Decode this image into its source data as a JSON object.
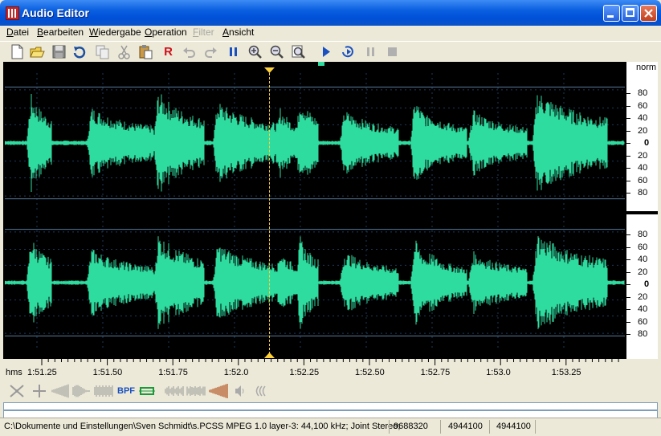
{
  "window": {
    "title": "Audio Editor"
  },
  "menu": [
    {
      "label": "Datei",
      "key": "D",
      "rest": "atei",
      "disabled": false
    },
    {
      "label": "Bearbeiten",
      "key": "B",
      "rest": "earbeiten",
      "disabled": false
    },
    {
      "label": "Wiedergabe",
      "key": "W",
      "rest": "iedergabe",
      "disabled": false
    },
    {
      "label": "Operation",
      "key": "O",
      "rest": "peration",
      "disabled": false
    },
    {
      "label": "Filter",
      "key": "F",
      "rest": "ilter",
      "disabled": true
    },
    {
      "label": "Ansicht",
      "key": "A",
      "rest": "nsicht",
      "disabled": false
    }
  ],
  "toolbar": {
    "buttons": [
      "new-file-icon",
      "open-folder-icon",
      "save-disk-icon",
      "reload-icon",
      "copy-icon",
      "cut-icon",
      "paste-icon",
      "record-icon",
      "undo-icon",
      "redo-icon",
      "pause-icon",
      "zoom-in-icon",
      "zoom-out-icon",
      "zoom-fit-icon",
      "play-icon",
      "loop-play-icon",
      "pause-disabled-icon",
      "stop-icon"
    ],
    "record_label": "R"
  },
  "scale": {
    "top_label": "norm",
    "ticks": [
      "80",
      "60",
      "40",
      "20",
      "0",
      "20",
      "40",
      "60",
      "80"
    ]
  },
  "timeline": {
    "unit": "hms",
    "labels": [
      "1:51.25",
      "1:51.50",
      "1:51.75",
      "1:52.0",
      "1:52.25",
      "1:52.50",
      "1:52.75",
      "1:53.0",
      "1:53.25"
    ]
  },
  "effects": {
    "bpf_label": "BPF"
  },
  "status": {
    "path": "C:\\Dokumente und Einstellungen\\Sven Schmidt\\s.PCS",
    "format": "S MPEG 1.0 layer-3: 44,100 kHz; Joint Stereo;",
    "samples_total": "9688320",
    "position_1": "4944100",
    "position_2": "4944100"
  },
  "colors": {
    "waveform": "#2fdca0",
    "background": "#000000",
    "cursor": "#ffd23a"
  }
}
